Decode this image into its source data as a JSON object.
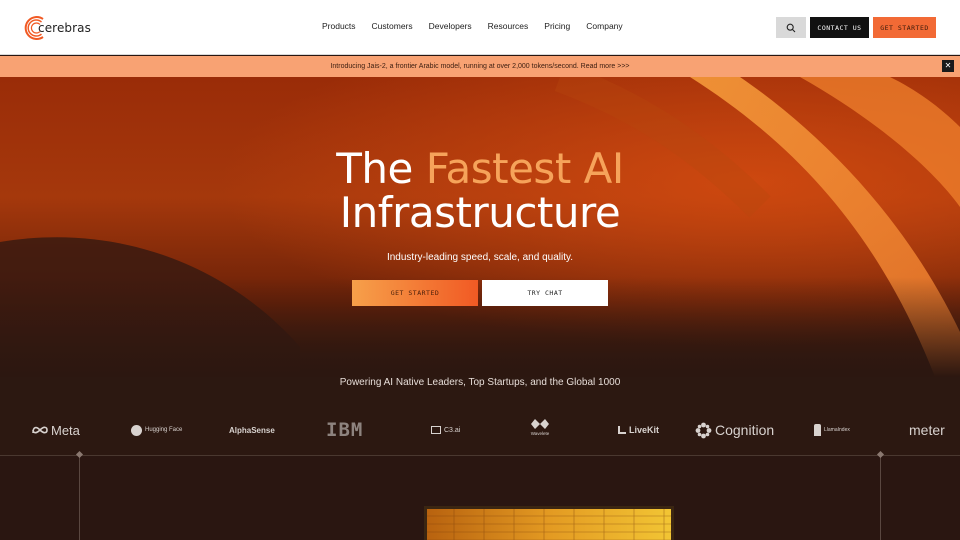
{
  "nav": {
    "logo_text": "cerebras",
    "links": [
      "Products",
      "Customers",
      "Developers",
      "Resources",
      "Pricing",
      "Company"
    ],
    "contact_label": "CONTACT US",
    "get_started_label": "GET STARTED"
  },
  "announcement": {
    "text": "Introducing Jais-2, a frontier Arabic model, running at over 2,000 tokens/second. Read more >>>",
    "close_label": "✕"
  },
  "hero": {
    "title_part1": "The ",
    "title_accent": "Fastest AI",
    "title_line2": "Infrastructure",
    "subtitle": "Industry-leading speed, scale, and quality.",
    "primary_button": "GET STARTED",
    "secondary_button": "TRY CHAT"
  },
  "customers": {
    "heading": "Powering AI Native Leaders, Top Startups, and the Global 1000",
    "logos": [
      "Meta",
      "Hugging Face",
      "AlphaSense",
      "IBM",
      "C3.ai",
      "Wavelete",
      "LiveKit",
      "Cognition",
      "LlamaIndex",
      "meter"
    ]
  },
  "colors": {
    "accent_orange": "#f26a35",
    "announcement_bg": "#f8a273",
    "hero_accent_text": "#f6a35a"
  }
}
